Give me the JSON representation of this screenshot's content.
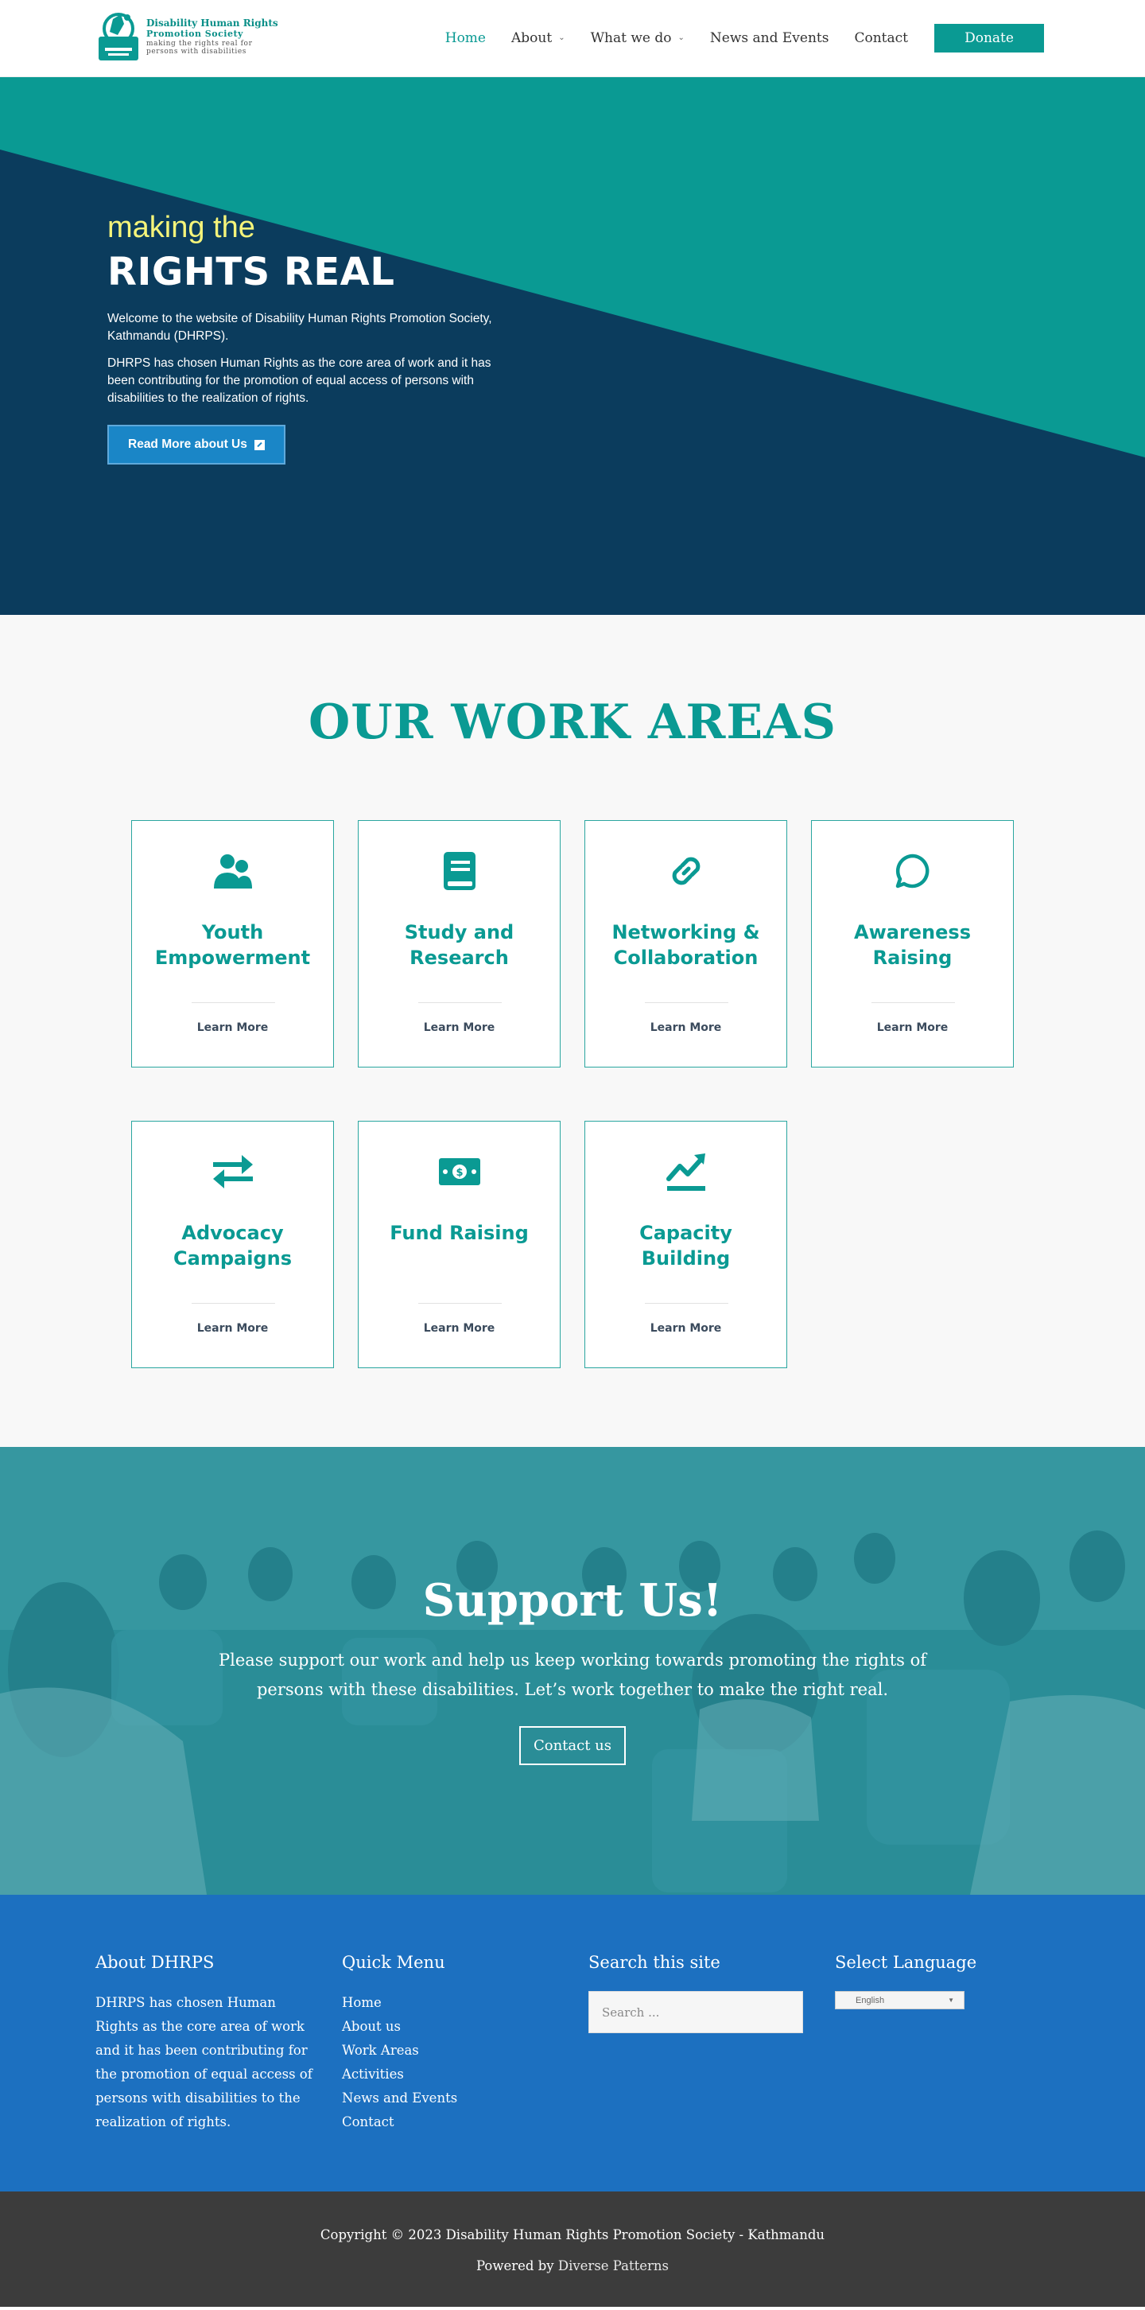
{
  "header": {
    "logo": {
      "line1": "Disability Human Rights",
      "line2": "Promotion Society",
      "line3": "making the rights real for",
      "line4": "persons with disabilities"
    },
    "nav": {
      "home": "Home",
      "about": "About",
      "what_we_do": "What we do",
      "news": "News and Events",
      "contact": "Contact",
      "donate": "Donate"
    }
  },
  "hero": {
    "kicker": "making the",
    "title": "RIGHTS REAL",
    "p1": "Welcome to the website of Disability Human Rights Promotion Society, Kathmandu (DHRPS).",
    "p2": "DHRPS has chosen Human Rights as the core area of work and it has been contributing for the promotion of equal access of persons with disabilities to the realization of rights.",
    "button": "Read More about Us",
    "colors": {
      "teal": "#0a9a93",
      "navy": "#0b3c5d"
    }
  },
  "work": {
    "title": "OUR WORK AREAS",
    "cards": [
      {
        "name": "Youth Empowerment",
        "icon": "users-icon",
        "more": "Learn More"
      },
      {
        "name": "Study and Research",
        "icon": "book-icon",
        "more": "Learn More"
      },
      {
        "name": "Networking & Collaboration",
        "icon": "link-icon",
        "more": "Learn More"
      },
      {
        "name": "Awareness Raising",
        "icon": "speech-bubble-icon",
        "more": "Learn More"
      },
      {
        "name": "Advocacy Campaigns",
        "icon": "exchange-arrows-icon",
        "more": "Learn More"
      },
      {
        "name": "Fund Raising",
        "icon": "money-bill-icon",
        "more": "Learn More"
      },
      {
        "name": "Capacity Building",
        "icon": "chart-line-icon",
        "more": "Learn More"
      }
    ]
  },
  "support": {
    "title": "Support Us!",
    "text": "Please support our work and help us keep working towards promoting the rights of persons with these disabilities. Let’s work together to make the right real.",
    "button": "Contact us"
  },
  "footer": {
    "about_title": "About DHRPS",
    "about_text": "DHRPS has chosen Human Rights as the core area of work and it has been contributing for the promotion of equal access of persons with disabilities to the realization of rights.",
    "menu_title": "Quick Menu",
    "menu": [
      "Home",
      "About us",
      "Work Areas",
      "Activities",
      "News and Events",
      "Contact"
    ],
    "search_title": "Search this site",
    "search_placeholder": "Search ...",
    "lang_title": "Select Language",
    "lang_value": "English"
  },
  "copyright": {
    "text": "Copyright © 2023 Disability Human Rights Promotion Society - Kathmandu",
    "powered_prefix": "Powered by",
    "powered_link": "Diverse Patterns"
  }
}
